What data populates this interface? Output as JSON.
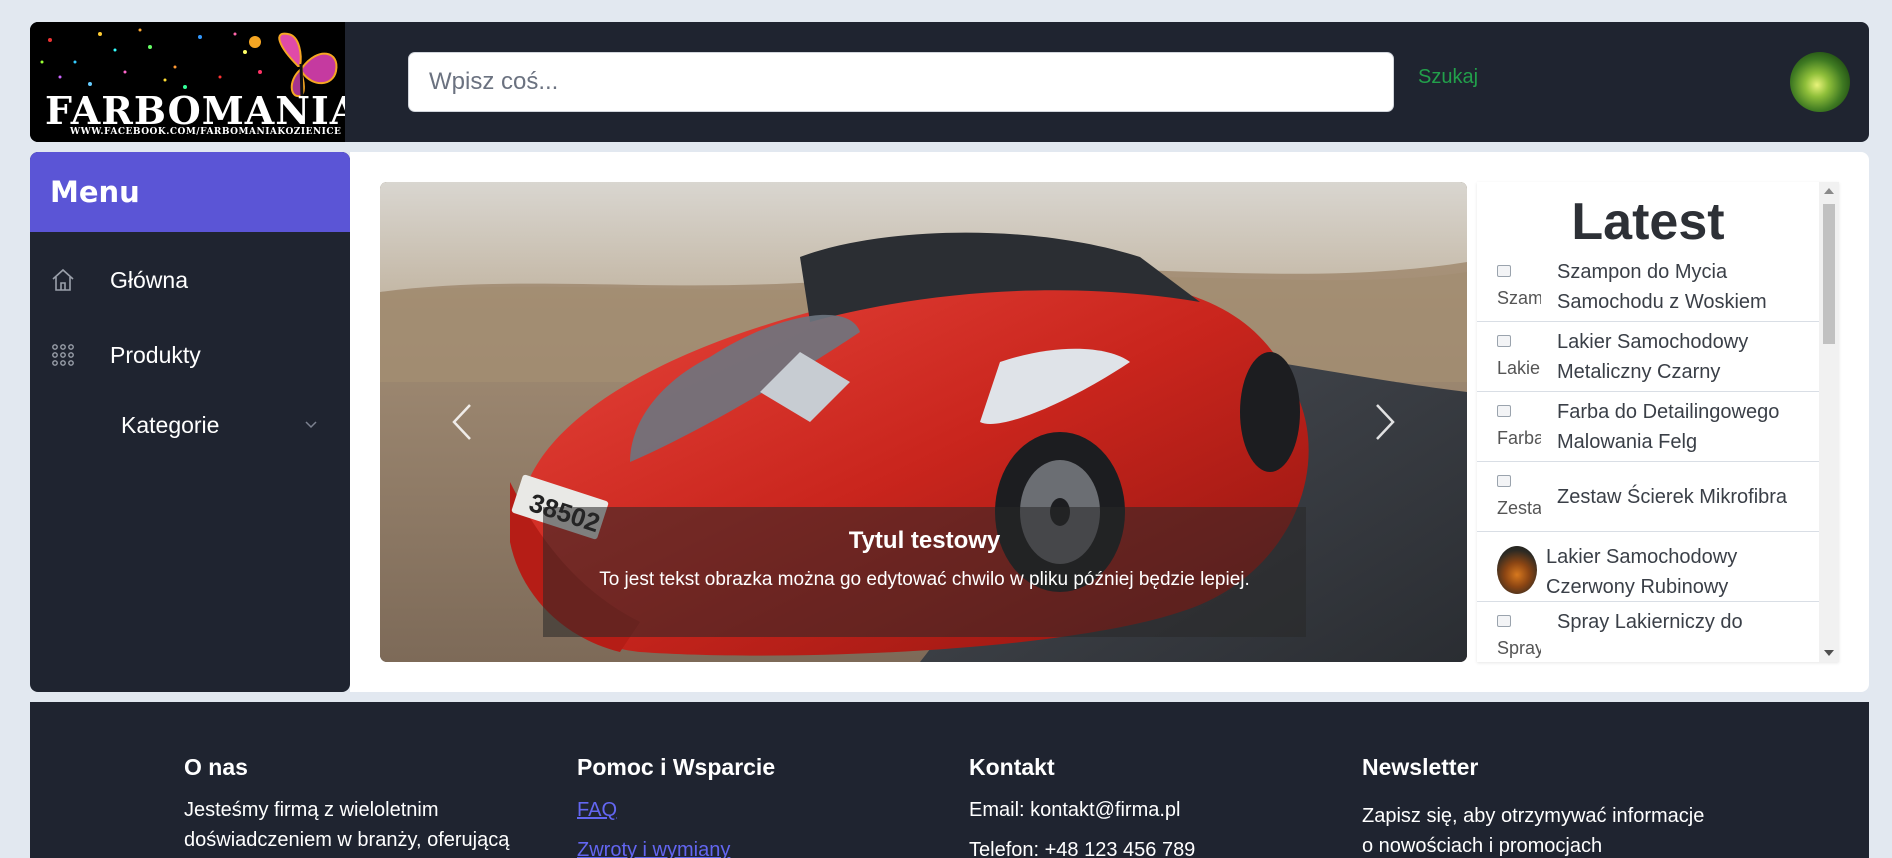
{
  "header": {
    "logo_text": "FARBOMANIA",
    "logo_subtext": "WWW.FACEBOOK.COM/FARBOMANIAKOZIENICE",
    "search_placeholder": "Wpisz coś...",
    "search_button": "Szukaj"
  },
  "sidebar": {
    "title": "Menu",
    "items": [
      {
        "label": "Główna",
        "icon": "home-icon"
      },
      {
        "label": "Produkty",
        "icon": "grid-dots-icon"
      },
      {
        "label": "Kategorie",
        "icon": "chevron-down-icon"
      }
    ]
  },
  "carousel": {
    "caption_title": "Tytul testowy",
    "caption_text": "To jest tekst obrazka można go edytować chwilo w pliku później będzie lepiej."
  },
  "latest": {
    "title": "Latest",
    "items": [
      {
        "name": "Szampon do Mycia Samochodu z Woskiem",
        "thumb_alt": "Szam"
      },
      {
        "name": "Lakier Samochodowy Metaliczny Czarny",
        "thumb_alt": "Lakie"
      },
      {
        "name": "Farba do Detailingowego Malowania Felg",
        "thumb_alt": "Farba"
      },
      {
        "name": "Zestaw Ścierek Mikrofibra",
        "thumb_alt": "Zesta"
      },
      {
        "name": "Lakier Samochodowy Czerwony Rubinowy",
        "thumb_alt": ""
      },
      {
        "name": "Spray Lakierniczy do",
        "thumb_alt": "Spray"
      }
    ]
  },
  "footer": {
    "about_title": "O nas",
    "about_text_1": "Jesteśmy firmą z wieloletnim",
    "about_text_2": "doświadczeniem w branży, oferującą",
    "help_title": "Pomoc i Wsparcie",
    "help_links": [
      "FAQ",
      "Zwroty i wymiany"
    ],
    "contact_title": "Kontakt",
    "contact_email": "Email: kontakt@firma.pl",
    "contact_phone": "Telefon: +48 123 456 789",
    "newsletter_title": "Newsletter",
    "newsletter_text_1": "Zapisz się, aby otrzymywać informacje",
    "newsletter_text_2": "o nowościach i promocjach"
  },
  "colors": {
    "header_bg": "#1f2430",
    "menu_accent": "#5b55d6",
    "search_button": "#22a04b",
    "link": "#6366f1",
    "page_bg": "#e2e8f0"
  }
}
